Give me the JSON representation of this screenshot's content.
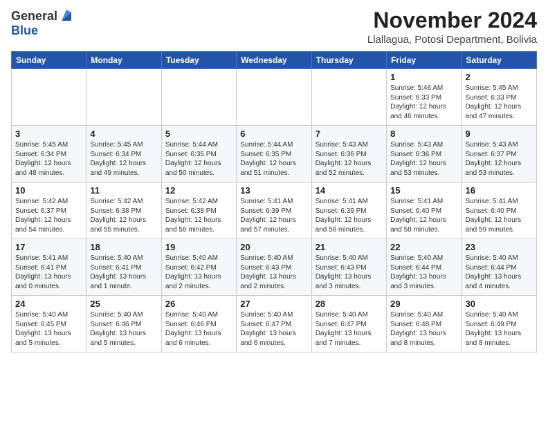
{
  "header": {
    "logo_general": "General",
    "logo_blue": "Blue",
    "month_title": "November 2024",
    "location": "Llallagua, Potosi Department, Bolivia"
  },
  "weekdays": [
    "Sunday",
    "Monday",
    "Tuesday",
    "Wednesday",
    "Thursday",
    "Friday",
    "Saturday"
  ],
  "weeks": [
    [
      {
        "day": "",
        "info": ""
      },
      {
        "day": "",
        "info": ""
      },
      {
        "day": "",
        "info": ""
      },
      {
        "day": "",
        "info": ""
      },
      {
        "day": "",
        "info": ""
      },
      {
        "day": "1",
        "info": "Sunrise: 5:46 AM\nSunset: 6:33 PM\nDaylight: 12 hours\nand 46 minutes."
      },
      {
        "day": "2",
        "info": "Sunrise: 5:45 AM\nSunset: 6:33 PM\nDaylight: 12 hours\nand 47 minutes."
      }
    ],
    [
      {
        "day": "3",
        "info": "Sunrise: 5:45 AM\nSunset: 6:34 PM\nDaylight: 12 hours\nand 48 minutes."
      },
      {
        "day": "4",
        "info": "Sunrise: 5:45 AM\nSunset: 6:34 PM\nDaylight: 12 hours\nand 49 minutes."
      },
      {
        "day": "5",
        "info": "Sunrise: 5:44 AM\nSunset: 6:35 PM\nDaylight: 12 hours\nand 50 minutes."
      },
      {
        "day": "6",
        "info": "Sunrise: 5:44 AM\nSunset: 6:35 PM\nDaylight: 12 hours\nand 51 minutes."
      },
      {
        "day": "7",
        "info": "Sunrise: 5:43 AM\nSunset: 6:36 PM\nDaylight: 12 hours\nand 52 minutes."
      },
      {
        "day": "8",
        "info": "Sunrise: 5:43 AM\nSunset: 6:36 PM\nDaylight: 12 hours\nand 53 minutes."
      },
      {
        "day": "9",
        "info": "Sunrise: 5:43 AM\nSunset: 6:37 PM\nDaylight: 12 hours\nand 53 minutes."
      }
    ],
    [
      {
        "day": "10",
        "info": "Sunrise: 5:42 AM\nSunset: 6:37 PM\nDaylight: 12 hours\nand 54 minutes."
      },
      {
        "day": "11",
        "info": "Sunrise: 5:42 AM\nSunset: 6:38 PM\nDaylight: 12 hours\nand 55 minutes."
      },
      {
        "day": "12",
        "info": "Sunrise: 5:42 AM\nSunset: 6:38 PM\nDaylight: 12 hours\nand 56 minutes."
      },
      {
        "day": "13",
        "info": "Sunrise: 5:41 AM\nSunset: 6:39 PM\nDaylight: 12 hours\nand 57 minutes."
      },
      {
        "day": "14",
        "info": "Sunrise: 5:41 AM\nSunset: 6:39 PM\nDaylight: 12 hours\nand 58 minutes."
      },
      {
        "day": "15",
        "info": "Sunrise: 5:41 AM\nSunset: 6:40 PM\nDaylight: 12 hours\nand 58 minutes."
      },
      {
        "day": "16",
        "info": "Sunrise: 5:41 AM\nSunset: 6:40 PM\nDaylight: 12 hours\nand 59 minutes."
      }
    ],
    [
      {
        "day": "17",
        "info": "Sunrise: 5:41 AM\nSunset: 6:41 PM\nDaylight: 13 hours\nand 0 minutes."
      },
      {
        "day": "18",
        "info": "Sunrise: 5:40 AM\nSunset: 6:41 PM\nDaylight: 13 hours\nand 1 minute."
      },
      {
        "day": "19",
        "info": "Sunrise: 5:40 AM\nSunset: 6:42 PM\nDaylight: 13 hours\nand 2 minutes."
      },
      {
        "day": "20",
        "info": "Sunrise: 5:40 AM\nSunset: 6:43 PM\nDaylight: 13 hours\nand 2 minutes."
      },
      {
        "day": "21",
        "info": "Sunrise: 5:40 AM\nSunset: 6:43 PM\nDaylight: 13 hours\nand 3 minutes."
      },
      {
        "day": "22",
        "info": "Sunrise: 5:40 AM\nSunset: 6:44 PM\nDaylight: 13 hours\nand 3 minutes."
      },
      {
        "day": "23",
        "info": "Sunrise: 5:40 AM\nSunset: 6:44 PM\nDaylight: 13 hours\nand 4 minutes."
      }
    ],
    [
      {
        "day": "24",
        "info": "Sunrise: 5:40 AM\nSunset: 6:45 PM\nDaylight: 13 hours\nand 5 minutes."
      },
      {
        "day": "25",
        "info": "Sunrise: 5:40 AM\nSunset: 6:46 PM\nDaylight: 13 hours\nand 5 minutes."
      },
      {
        "day": "26",
        "info": "Sunrise: 5:40 AM\nSunset: 6:46 PM\nDaylight: 13 hours\nand 6 minutes."
      },
      {
        "day": "27",
        "info": "Sunrise: 5:40 AM\nSunset: 6:47 PM\nDaylight: 13 hours\nand 6 minutes."
      },
      {
        "day": "28",
        "info": "Sunrise: 5:40 AM\nSunset: 6:47 PM\nDaylight: 13 hours\nand 7 minutes."
      },
      {
        "day": "29",
        "info": "Sunrise: 5:40 AM\nSunset: 6:48 PM\nDaylight: 13 hours\nand 8 minutes."
      },
      {
        "day": "30",
        "info": "Sunrise: 5:40 AM\nSunset: 6:49 PM\nDaylight: 13 hours\nand 8 minutes."
      }
    ]
  ]
}
